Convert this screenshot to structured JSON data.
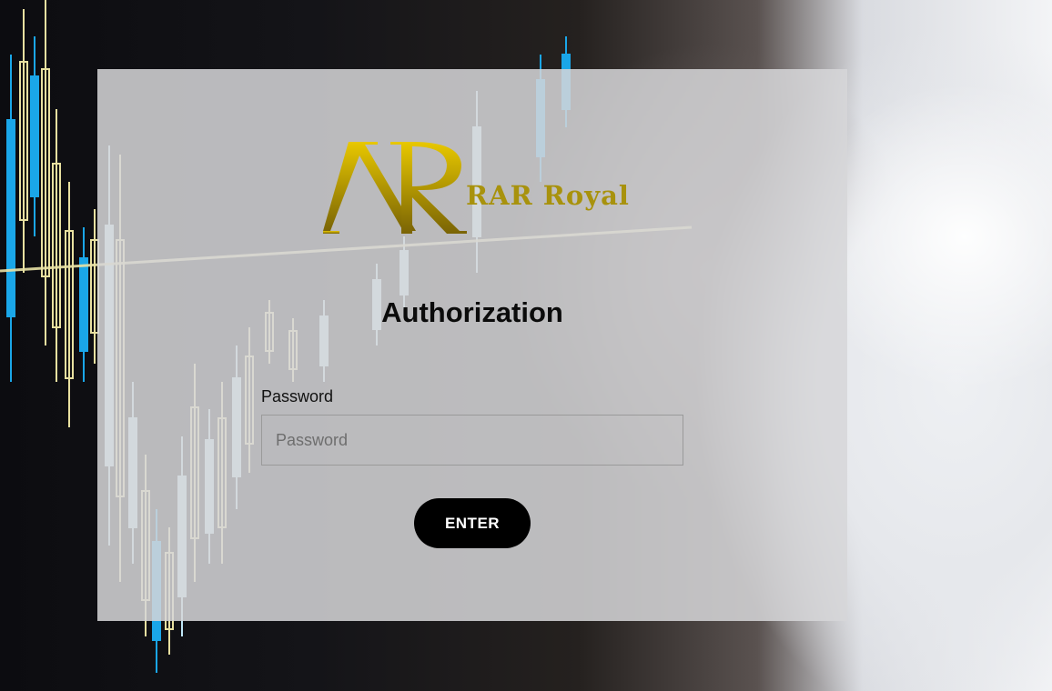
{
  "brand": {
    "logo_text": "RAR Royal",
    "logo_mark": "AR",
    "color": "#a8920d"
  },
  "auth": {
    "title": "Authorization",
    "password_label": "Password",
    "password_placeholder": "Password",
    "password_value": "",
    "submit_label": "ENTER"
  },
  "colors": {
    "button_bg": "#000000",
    "button_text": "#ffffff",
    "card_bg": "#d6d6d8"
  },
  "background": {
    "description_icon": "candlestick-chart-background"
  }
}
